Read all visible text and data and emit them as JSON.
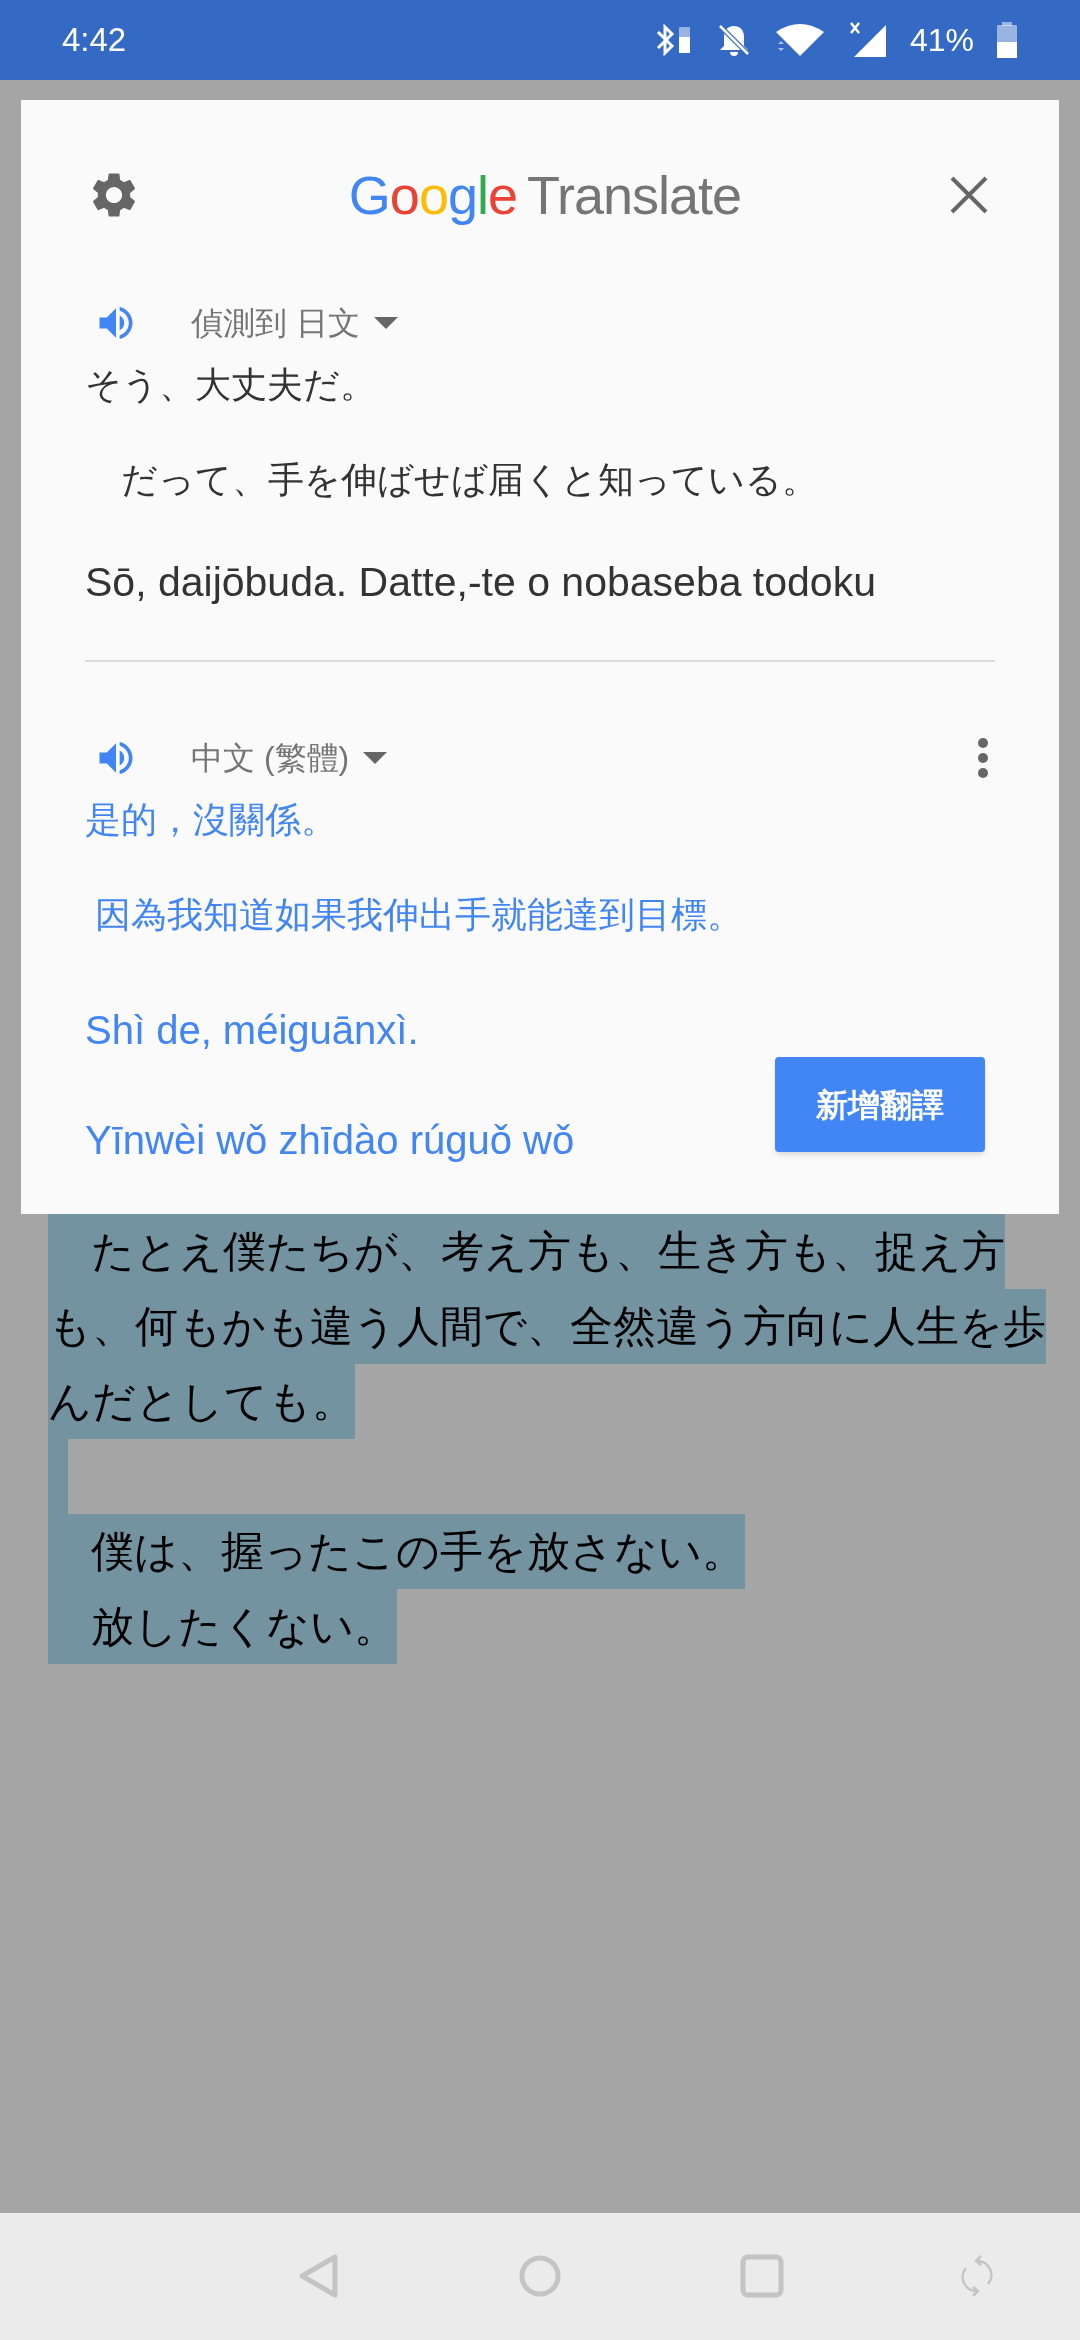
{
  "status_bar": {
    "time": "4:42",
    "battery": "41%"
  },
  "card": {
    "logo": "Google",
    "title": "Translate",
    "source": {
      "language": "偵測到 日文",
      "lines": [
        "そう、大丈夫だ。",
        "　だって、手を伸ばせば届くと知っている。"
      ],
      "romanization": "Sō, daijōbuda. Datte,-te o nobaseba todoku"
    },
    "target": {
      "language": "中文 (繁體)",
      "lines": [
        "是的，沒關係。",
        " 因為我知道如果我伸出手就能達到目標。"
      ],
      "romanization": [
        "Shì de, méiguānxì.",
        "Yīnwèi wǒ zhīdào rúguǒ wǒ"
      ]
    },
    "button": "新增翻譯"
  },
  "page_text": [
    {
      "kind": "text",
      "text": "　たとえ僕たちが、考え方も、生き方も、捉え方"
    },
    {
      "kind": "text",
      "text": "も、何もかも違う人間で、全然違う方向に人生を歩"
    },
    {
      "kind": "text",
      "text": "んだとしても。"
    },
    {
      "kind": "blank"
    },
    {
      "kind": "text",
      "text": "　僕は、握ったこの手を放さない。"
    },
    {
      "kind": "text",
      "text": "　放したくない。"
    }
  ]
}
